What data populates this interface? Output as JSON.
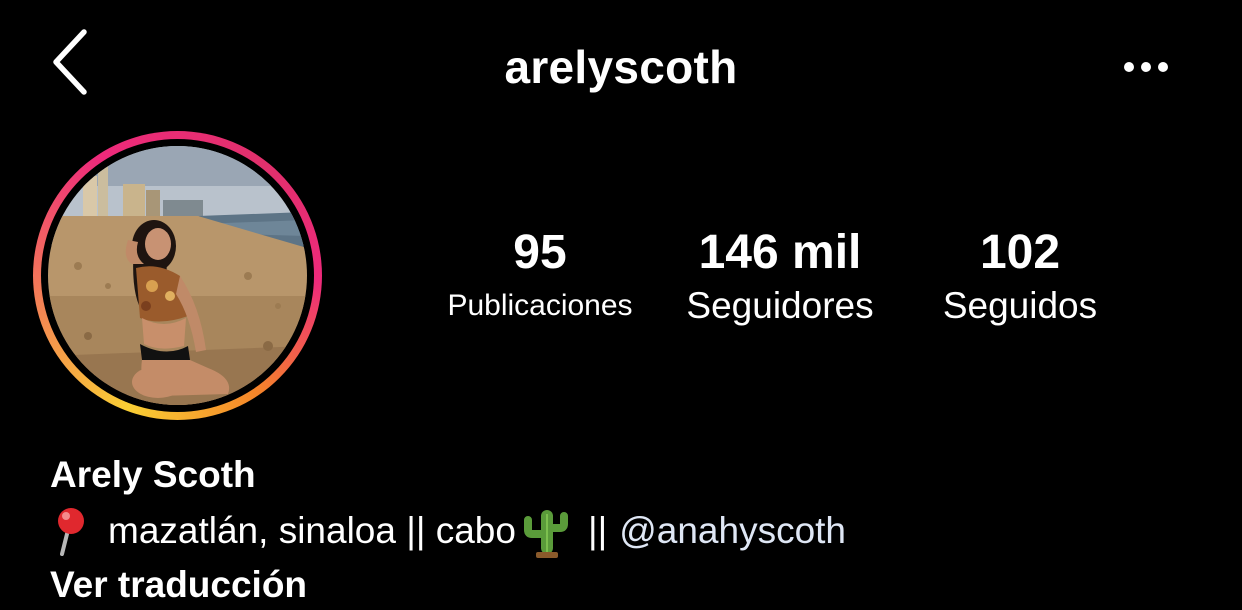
{
  "header": {
    "username": "arelyscoth",
    "back_icon": "chevron-left-icon",
    "more_icon": "more-horizontal-icon"
  },
  "avatar": {
    "has_story_ring": true,
    "ring_colors": [
      "#f9ce34",
      "#ee2a7b",
      "#e1306c",
      "#f58529"
    ]
  },
  "stats": {
    "posts": {
      "value": "95",
      "label": "Publicaciones"
    },
    "followers": {
      "value": "146 mil",
      "label": "Seguidores"
    },
    "following": {
      "value": "102",
      "label": "Seguidos"
    }
  },
  "bio": {
    "name": "Arely Scoth",
    "location_icon": "round-pushpin-icon",
    "location_text": "mazatlán, sinaloa || cabo",
    "cactus_icon": "cactus-icon",
    "separator": "||",
    "mention": "@anahyscoth",
    "translate_link": "Ver traducción"
  },
  "colors": {
    "background": "#000000",
    "text": "#ffffff",
    "mention": "#dfe7f5"
  }
}
